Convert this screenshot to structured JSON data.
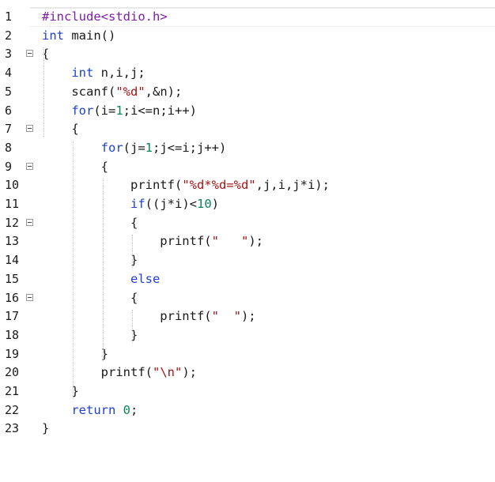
{
  "editor": {
    "lines": [
      {
        "n": "1",
        "tokens": [
          {
            "t": "#include<stdio.h>",
            "c": "pp"
          }
        ]
      },
      {
        "n": "2",
        "tokens": [
          {
            "t": "int",
            "c": "kw"
          },
          {
            "t": " main()",
            "c": ""
          }
        ]
      },
      {
        "n": "3",
        "fold": true,
        "tokens": [
          {
            "t": "{",
            "c": ""
          }
        ]
      },
      {
        "n": "4",
        "tokens": [
          {
            "t": "    ",
            "c": ""
          },
          {
            "t": "int",
            "c": "kw"
          },
          {
            "t": " n,i,j;",
            "c": ""
          }
        ]
      },
      {
        "n": "5",
        "tokens": [
          {
            "t": "    scanf(",
            "c": ""
          },
          {
            "t": "\"%d\"",
            "c": "str"
          },
          {
            "t": ",&n);",
            "c": ""
          }
        ]
      },
      {
        "n": "6",
        "tokens": [
          {
            "t": "    ",
            "c": ""
          },
          {
            "t": "for",
            "c": "kw"
          },
          {
            "t": "(i=",
            "c": ""
          },
          {
            "t": "1",
            "c": "num"
          },
          {
            "t": ";i<=n;i++)",
            "c": ""
          }
        ]
      },
      {
        "n": "7",
        "fold": true,
        "tokens": [
          {
            "t": "    {",
            "c": ""
          }
        ]
      },
      {
        "n": "8",
        "tokens": [
          {
            "t": "        ",
            "c": ""
          },
          {
            "t": "for",
            "c": "kw"
          },
          {
            "t": "(j=",
            "c": ""
          },
          {
            "t": "1",
            "c": "num"
          },
          {
            "t": ";j<=i;j++)",
            "c": ""
          }
        ]
      },
      {
        "n": "9",
        "fold": true,
        "tokens": [
          {
            "t": "        {",
            "c": ""
          }
        ]
      },
      {
        "n": "10",
        "tokens": [
          {
            "t": "            printf(",
            "c": ""
          },
          {
            "t": "\"%d*%d=%d\"",
            "c": "str"
          },
          {
            "t": ",j,i,j*i);",
            "c": ""
          }
        ]
      },
      {
        "n": "11",
        "tokens": [
          {
            "t": "            ",
            "c": ""
          },
          {
            "t": "if",
            "c": "kw"
          },
          {
            "t": "((j*i)<",
            "c": ""
          },
          {
            "t": "10",
            "c": "num"
          },
          {
            "t": ")",
            "c": ""
          }
        ]
      },
      {
        "n": "12",
        "fold": true,
        "tokens": [
          {
            "t": "            {",
            "c": ""
          }
        ]
      },
      {
        "n": "13",
        "tokens": [
          {
            "t": "                printf(",
            "c": ""
          },
          {
            "t": "\"   \"",
            "c": "str"
          },
          {
            "t": ");",
            "c": ""
          }
        ]
      },
      {
        "n": "14",
        "tokens": [
          {
            "t": "            }",
            "c": ""
          }
        ]
      },
      {
        "n": "15",
        "tokens": [
          {
            "t": "            ",
            "c": ""
          },
          {
            "t": "else",
            "c": "kw"
          }
        ]
      },
      {
        "n": "16",
        "fold": true,
        "tokens": [
          {
            "t": "            {",
            "c": ""
          }
        ]
      },
      {
        "n": "17",
        "tokens": [
          {
            "t": "                printf(",
            "c": ""
          },
          {
            "t": "\"  \"",
            "c": "str"
          },
          {
            "t": ");",
            "c": ""
          }
        ]
      },
      {
        "n": "18",
        "tokens": [
          {
            "t": "            }",
            "c": ""
          }
        ]
      },
      {
        "n": "19",
        "tokens": [
          {
            "t": "        }",
            "c": ""
          }
        ]
      },
      {
        "n": "20",
        "tokens": [
          {
            "t": "        printf(",
            "c": ""
          },
          {
            "t": "\"",
            "c": "str"
          },
          {
            "t": "\\n",
            "c": "esc"
          },
          {
            "t": "\"",
            "c": "str"
          },
          {
            "t": ");",
            "c": ""
          }
        ]
      },
      {
        "n": "21",
        "tokens": [
          {
            "t": "    }",
            "c": ""
          }
        ]
      },
      {
        "n": "22",
        "tokens": [
          {
            "t": "    ",
            "c": ""
          },
          {
            "t": "return",
            "c": "kw"
          },
          {
            "t": " ",
            "c": ""
          },
          {
            "t": "0",
            "c": "num"
          },
          {
            "t": ";",
            "c": ""
          }
        ]
      },
      {
        "n": "23",
        "tokens": [
          {
            "t": "}",
            "c": ""
          }
        ]
      }
    ]
  }
}
